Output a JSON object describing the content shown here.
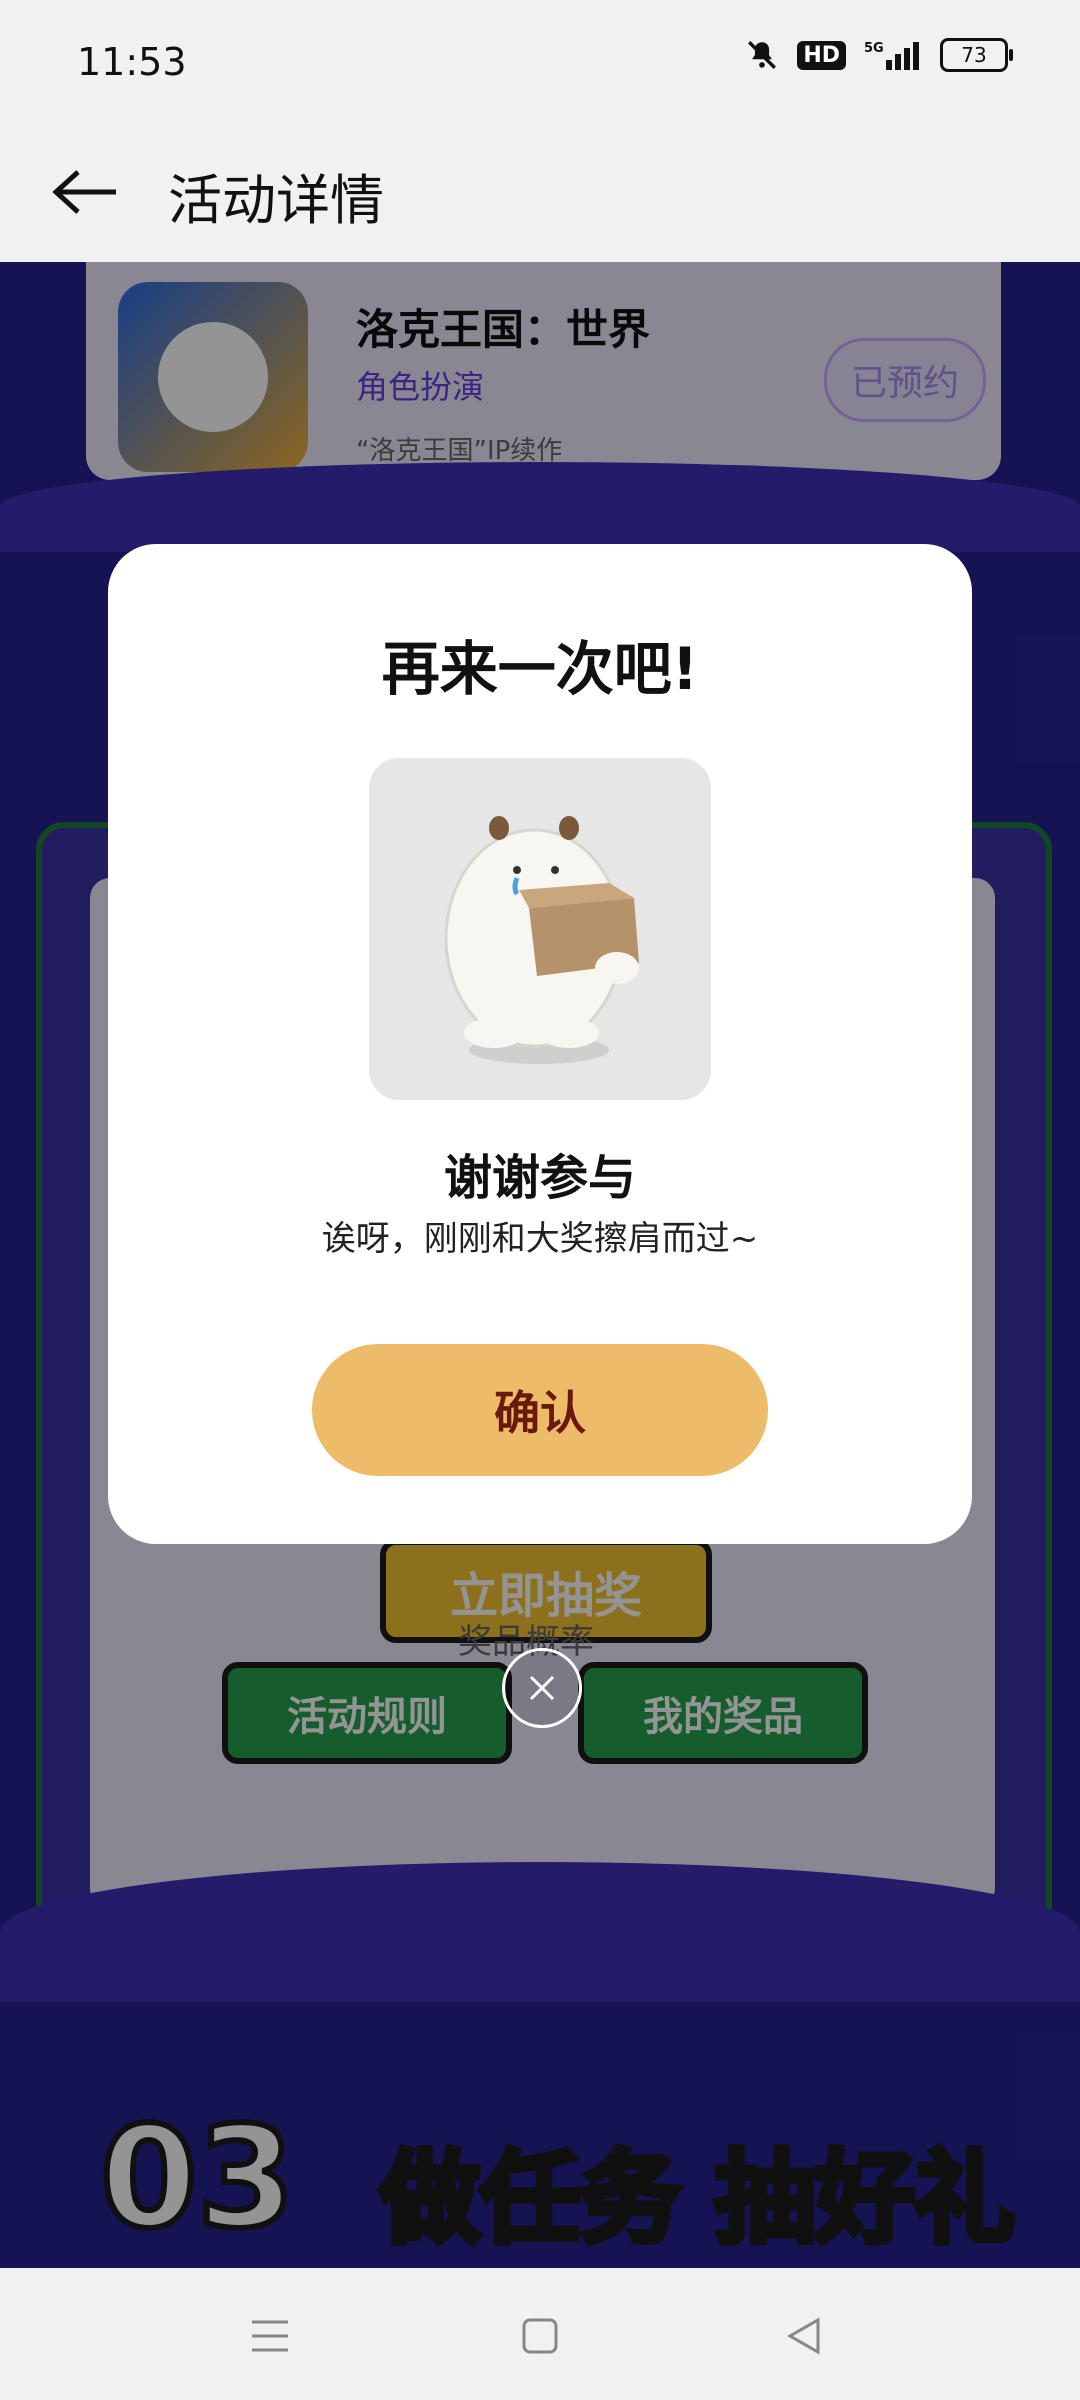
{
  "status_bar": {
    "time": "11:53",
    "hd": "HD",
    "network": "5G",
    "battery": "73"
  },
  "header": {
    "title": "活动详情"
  },
  "background": {
    "game": {
      "name": "洛克王国：世界",
      "genre": "角色扮演",
      "desc": "“洛克王国”IP续作",
      "reserved_label": "已预约"
    },
    "lottery_button": "立即抽奖",
    "prob_link": "奖品概率",
    "rules_button": "活动规则",
    "prizes_button": "我的奖品",
    "task_section_number": "03",
    "task_section_title": "做任务 抽好礼"
  },
  "modal": {
    "title": "再来一次吧!",
    "result_title": "谢谢参与",
    "result_subtitle": "诶呀，刚刚和大奖擦肩而过~",
    "confirm_label": "确认"
  },
  "colors": {
    "accent": "#ecbc69",
    "confirm_text": "#6a1a0d",
    "background_purple": "#27228f"
  }
}
